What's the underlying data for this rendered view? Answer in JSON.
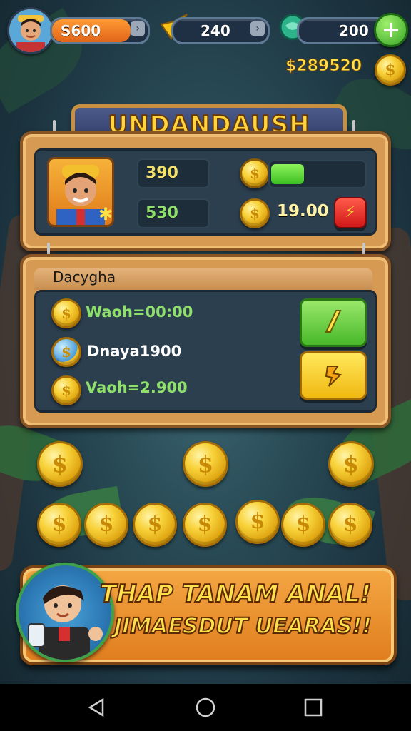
{
  "hud": {
    "cash_value": "S600",
    "energy_value": "240",
    "gems_value": "200",
    "add_label": "+",
    "sub_balance": "$289520"
  },
  "banner": {
    "title": "UNDANDAUSH"
  },
  "profile": {
    "stat1": "390",
    "stat2": "530",
    "coin_amount": "19.00",
    "progress_fraction": 0.35
  },
  "rewards": {
    "title": "Dacygha",
    "rows": [
      {
        "label": "Waoh=00:00",
        "icon": "coin-icon"
      },
      {
        "label": "Dnaya1900",
        "icon": "gem-coin-icon"
      },
      {
        "label": "Vaoh=2.900",
        "icon": "coin-icon"
      }
    ]
  },
  "promo": {
    "line1": "THAP TANAM ANAL!",
    "line2": "JIMAESDUT UEARAS!!"
  },
  "colors": {
    "gold": "#f8d23a",
    "green": "#6fd13c",
    "orange": "#e88a24",
    "red": "#e02a2a",
    "panel": "#d79a52"
  }
}
